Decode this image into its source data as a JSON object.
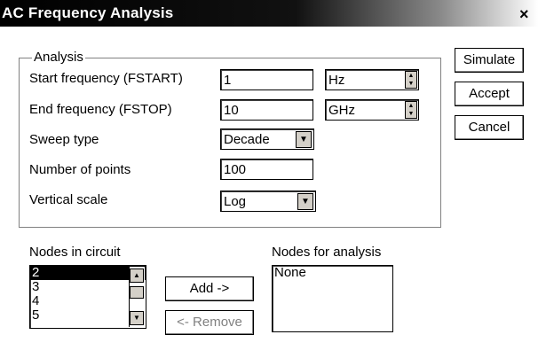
{
  "window": {
    "title": "AC Frequency Analysis",
    "close_glyph": "×"
  },
  "analysis": {
    "group_label": "Analysis",
    "start_frequency": {
      "label": "Start frequency (FSTART)",
      "value": "1",
      "unit": "Hz"
    },
    "end_frequency": {
      "label": "End frequency (FSTOP)",
      "value": "10",
      "unit": "GHz"
    },
    "sweep_type": {
      "label": "Sweep type",
      "value": "Decade"
    },
    "number_of_points": {
      "label": "Number of points",
      "value": "100"
    },
    "vertical_scale": {
      "label": "Vertical scale",
      "value": "Log"
    }
  },
  "buttons": {
    "simulate": "Simulate",
    "accept": "Accept",
    "cancel": "Cancel",
    "add": "Add ->",
    "remove": "<- Remove"
  },
  "nodes_in_circuit": {
    "label": "Nodes in circuit",
    "items": [
      "2",
      "3",
      "4",
      "5"
    ],
    "selected_index": 0
  },
  "nodes_for_analysis": {
    "label": "Nodes for analysis",
    "items": [
      "None"
    ]
  }
}
